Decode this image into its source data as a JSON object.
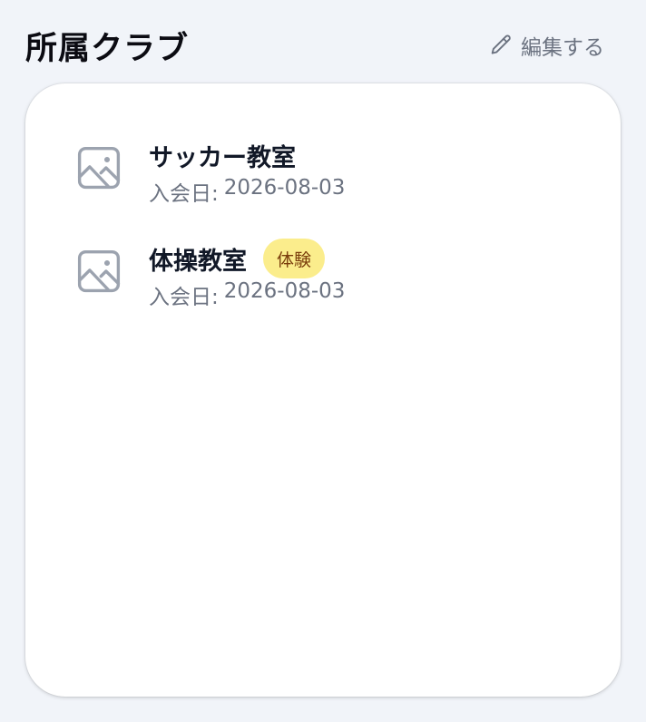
{
  "header": {
    "title": "所属クラブ",
    "edit_label": "編集する",
    "edit_icon": "pencil-icon"
  },
  "clubs": [
    {
      "name": "サッカー教室",
      "badge": "",
      "joined_label": "入会日:",
      "joined_date": "2026-08-03",
      "icon": "image-placeholder-icon"
    },
    {
      "name": "体操教室",
      "badge": "体験",
      "joined_label": "入会日:",
      "joined_date": "2026-08-03",
      "icon": "image-placeholder-icon"
    }
  ],
  "colors": {
    "background": "#f1f4f9",
    "card": "#ffffff",
    "badge_bg": "#fbed8c",
    "badge_text": "#7a3e0c",
    "muted_text": "#6b7280"
  }
}
